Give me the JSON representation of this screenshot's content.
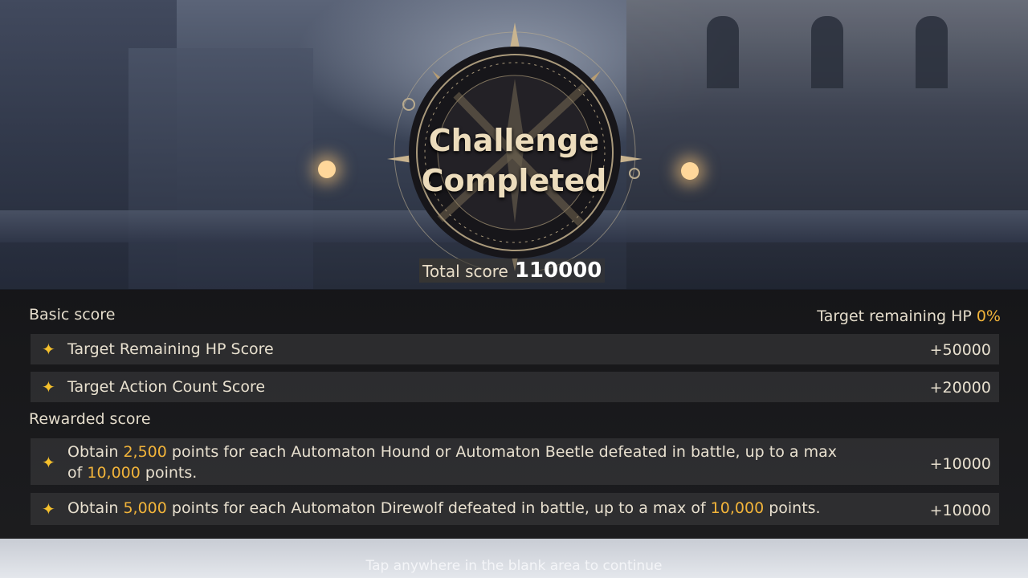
{
  "result": {
    "title_line1": "Challenge",
    "title_line2": "Completed",
    "total_label": "Total score",
    "total_value": "110000"
  },
  "basic": {
    "heading": "Basic score",
    "hp_label": "Target remaining HP",
    "hp_percent": "0%",
    "rows": [
      {
        "label": "Target Remaining HP Score",
        "value": "+50000"
      },
      {
        "label": "Target Action Count Score",
        "value": "+20000"
      }
    ]
  },
  "rewarded": {
    "heading": "Rewarded score",
    "rows": [
      {
        "t1": "Obtain ",
        "n1": "2,500",
        "t2": " points for each Automaton Hound or Automaton Beetle defeated in battle, up to a max",
        "t3": "of ",
        "n2": "10,000",
        "t4": " points.",
        "value": "+10000"
      },
      {
        "t1": "Obtain ",
        "n1": "5,000",
        "t2": " points for each Automaton Direwolf defeated in battle, up to a max of ",
        "n2": "10,000",
        "t3": " points.",
        "value": "+10000"
      }
    ]
  },
  "footer": {
    "hint": "Tap anywhere in the blank area to continue"
  },
  "icons": {
    "bullet": "four-point-star-icon",
    "emblem": "compass-star-emblem-icon"
  },
  "colors": {
    "highlight": "#f2b43a",
    "star": "#f5c02c",
    "title": "#ecdcbc"
  }
}
